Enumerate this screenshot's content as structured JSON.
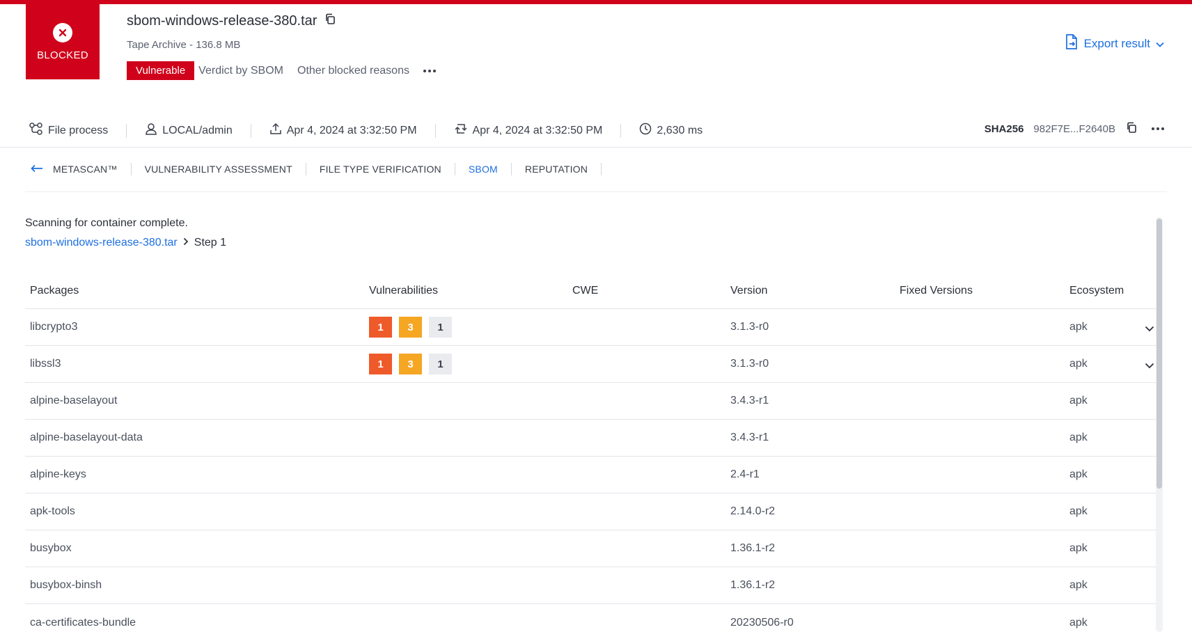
{
  "header": {
    "verdict_label": "BLOCKED",
    "file_name": "sbom-windows-release-380.tar",
    "file_type": "Tape Archive - 136.8 MB",
    "verdict_badge": "Vulnerable",
    "verdict_source": "Verdict by SBOM",
    "other_reasons": "Other blocked reasons",
    "export_label": "Export result"
  },
  "meta": {
    "file_process": "File process",
    "user": "LOCAL/admin",
    "uploaded": "Apr 4, 2024 at 3:32:50 PM",
    "processed": "Apr 4, 2024 at 3:32:50 PM",
    "duration": "2,630 ms",
    "sha_label": "SHA256",
    "sha_value": "982F7E...F2640B"
  },
  "tabs": [
    "METASCAN™",
    "VULNERABILITY ASSESSMENT",
    "FILE TYPE VERIFICATION",
    "SBOM",
    "REPUTATION"
  ],
  "active_tab": "SBOM",
  "scan": {
    "message": "Scanning for container complete.",
    "breadcrumb_link": "sbom-windows-release-380.tar",
    "breadcrumb_step": "Step 1"
  },
  "table": {
    "columns": [
      "Packages",
      "Vulnerabilities",
      "CWE",
      "Version",
      "Fixed Versions",
      "Ecosystem"
    ],
    "rows": [
      {
        "package": "libcrypto3",
        "vulns": [
          "1",
          "3",
          "1"
        ],
        "cwe": "",
        "version": "3.1.3-r0",
        "fixed": "",
        "ecosystem": "apk",
        "expandable": true
      },
      {
        "package": "libssl3",
        "vulns": [
          "1",
          "3",
          "1"
        ],
        "cwe": "",
        "version": "3.1.3-r0",
        "fixed": "",
        "ecosystem": "apk",
        "expandable": true
      },
      {
        "package": "alpine-baselayout",
        "vulns": [],
        "cwe": "",
        "version": "3.4.3-r1",
        "fixed": "",
        "ecosystem": "apk",
        "expandable": false
      },
      {
        "package": "alpine-baselayout-data",
        "vulns": [],
        "cwe": "",
        "version": "3.4.3-r1",
        "fixed": "",
        "ecosystem": "apk",
        "expandable": false
      },
      {
        "package": "alpine-keys",
        "vulns": [],
        "cwe": "",
        "version": "2.4-r1",
        "fixed": "",
        "ecosystem": "apk",
        "expandable": false
      },
      {
        "package": "apk-tools",
        "vulns": [],
        "cwe": "",
        "version": "2.14.0-r2",
        "fixed": "",
        "ecosystem": "apk",
        "expandable": false
      },
      {
        "package": "busybox",
        "vulns": [],
        "cwe": "",
        "version": "1.36.1-r2",
        "fixed": "",
        "ecosystem": "apk",
        "expandable": false
      },
      {
        "package": "busybox-binsh",
        "vulns": [],
        "cwe": "",
        "version": "1.36.1-r2",
        "fixed": "",
        "ecosystem": "apk",
        "expandable": false
      },
      {
        "package": "ca-certificates-bundle",
        "vulns": [],
        "cwe": "",
        "version": "20230506-r0",
        "fixed": "",
        "ecosystem": "apk",
        "expandable": false
      }
    ]
  },
  "colors": {
    "blocked_red": "#d0021b",
    "link_blue": "#1d6fe0",
    "critical": "#ef5a2a",
    "high": "#f5a623",
    "low": "#e9ebee"
  }
}
